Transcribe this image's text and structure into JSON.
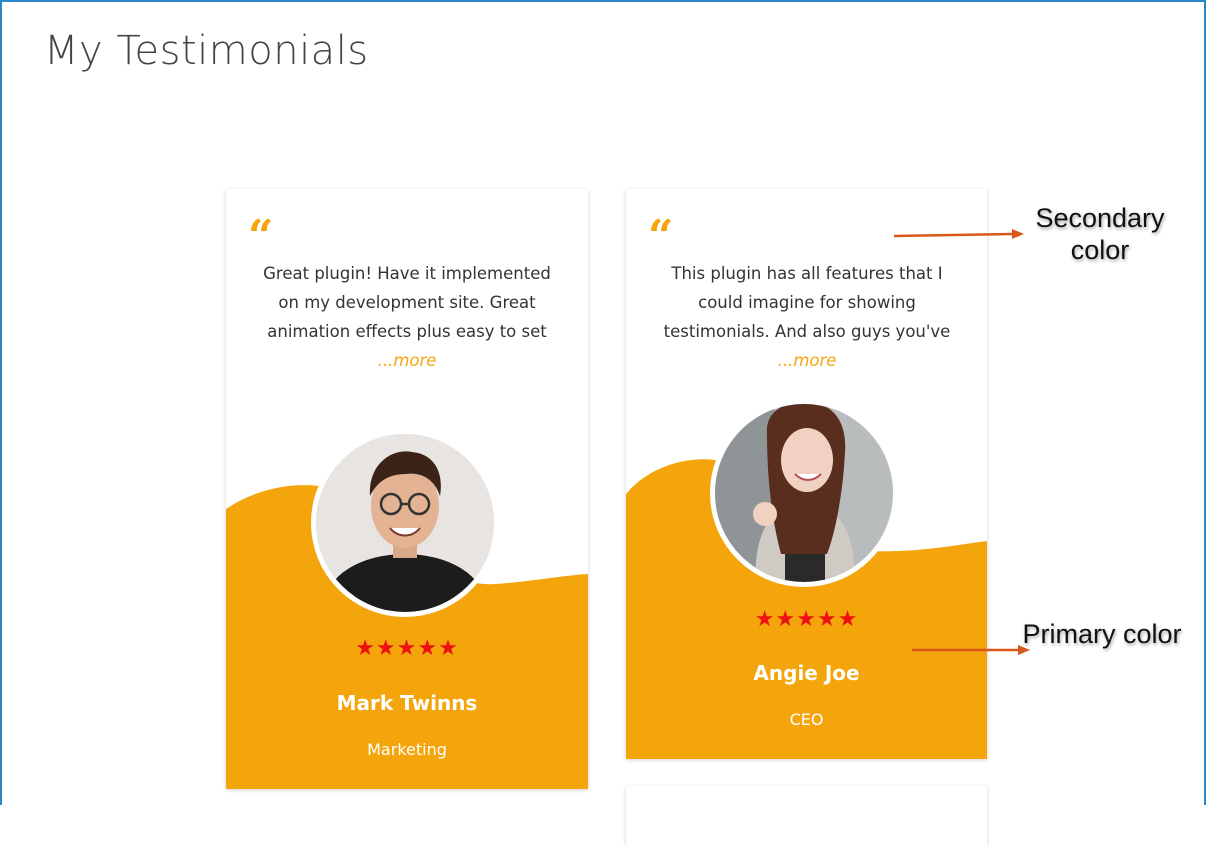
{
  "page": {
    "title": "My Testimonials"
  },
  "colors": {
    "primary": "#f5a50c",
    "star": "#ee1111",
    "annotation_arrow": "#d9571a"
  },
  "testimonials": [
    {
      "quote_icon": "“",
      "text": "Great plugin! Have it implemented on my development site. Great animation effects plus easy to set",
      "more_label": "...more",
      "avatar_icon": "avatar-photo-man",
      "stars": "★★★★★",
      "rating": 5,
      "name": "Mark Twinns",
      "role": "Marketing"
    },
    {
      "quote_icon": "“",
      "text": "This plugin has all features that I could imagine for showing testimonials. And also guys you've",
      "more_label": "...more",
      "avatar_icon": "avatar-photo-woman",
      "stars": "★★★★★",
      "rating": 5,
      "name": "Angie Joe",
      "role": "CEO"
    }
  ],
  "annotations": {
    "secondary": "Secondary color",
    "primary": "Primary color"
  }
}
